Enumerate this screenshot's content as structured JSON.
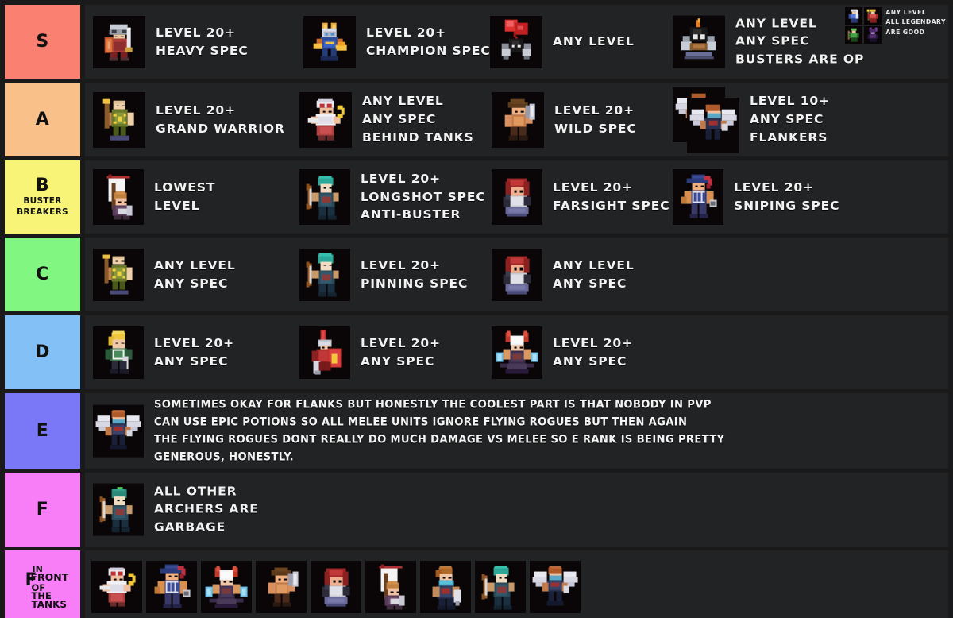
{
  "meta": {
    "background": "#1a1a1a",
    "row_bg": "#222325",
    "thumb_bg": "#0a0607",
    "text_color": "#f2f2f2"
  },
  "legend": {
    "lines": [
      "ANY LEVEL",
      "ALL LEGENDARY",
      "ARE GOOD"
    ],
    "thumbs": [
      "legendary-knight-icon",
      "legendary-mage-icon",
      "legendary-ranger-icon",
      "legendary-dark-icon"
    ]
  },
  "tiers": [
    {
      "id": "s",
      "label": "S",
      "sublabel": "",
      "color": "#fa8072",
      "entries": [
        {
          "icon": "heavy-knight-sprite",
          "lines": [
            "LEVEL 20+",
            "HEAVY SPEC"
          ]
        },
        {
          "icon": "champion-sprite",
          "lines": [
            "LEVEL 20+",
            "CHAMPION SPEC"
          ]
        },
        {
          "icon": "balloon-bomb-sprite",
          "lines": [
            "ANY LEVEL"
          ]
        },
        {
          "icon": "buster-bomb-sprite",
          "lines": [
            "ANY LEVEL",
            "ANY SPEC",
            "BUSTERS ARE OP"
          ]
        }
      ]
    },
    {
      "id": "a",
      "label": "A",
      "sublabel": "",
      "color": "#fac08a",
      "entries": [
        {
          "icon": "grand-warrior-sprite",
          "lines": [
            "LEVEL 20+",
            "GRAND WARRIOR"
          ]
        },
        {
          "icon": "white-cleric-sprite",
          "lines": [
            "ANY LEVEL",
            "ANY SPEC",
            "BEHIND TANKS"
          ]
        },
        {
          "icon": "wild-gunner-sprite",
          "lines": [
            "LEVEL 20+",
            "WILD SPEC"
          ]
        },
        {
          "icon": "flying-rogue-pair-sprite",
          "lines": [
            "LEVEL 10+",
            "ANY SPEC",
            "FLANKERS"
          ]
        }
      ]
    },
    {
      "id": "b",
      "label": "B",
      "sublabel": "BUSTER\nBREAKERS",
      "color": "#f7f478",
      "entries": [
        {
          "icon": "banner-bearer-sprite",
          "lines": [
            "LOWEST",
            "LEVEL"
          ]
        },
        {
          "icon": "longshot-archer-sprite",
          "lines": [
            "LEVEL 20+",
            "LONGSHOT SPEC",
            "ANTI-BUSTER"
          ]
        },
        {
          "icon": "farsight-gunner-sprite",
          "lines": [
            "LEVEL 20+",
            "FARSIGHT SPEC"
          ]
        },
        {
          "icon": "sniper-captain-sprite",
          "lines": [
            "LEVEL 20+",
            "SNIPING SPEC"
          ]
        }
      ]
    },
    {
      "id": "c",
      "label": "C",
      "sublabel": "",
      "color": "#81f781",
      "entries": [
        {
          "icon": "grand-warrior-sprite",
          "lines": [
            "ANY LEVEL",
            "ANY SPEC"
          ]
        },
        {
          "icon": "pinning-archer-sprite",
          "lines": [
            "LEVEL 20+",
            "PINNING SPEC"
          ]
        },
        {
          "icon": "farsight-gunner-sprite",
          "lines": [
            "ANY LEVEL",
            "ANY SPEC"
          ]
        }
      ]
    },
    {
      "id": "d",
      "label": "D",
      "sublabel": "",
      "color": "#82c0f5",
      "entries": [
        {
          "icon": "blonde-duelist-sprite",
          "lines": [
            "LEVEL 20+",
            "ANY SPEC"
          ]
        },
        {
          "icon": "red-shield-knight-sprite",
          "lines": [
            "LEVEL 20+",
            "ANY SPEC"
          ]
        },
        {
          "icon": "horned-caster-sprite",
          "lines": [
            "LEVEL 20+",
            "ANY SPEC"
          ]
        }
      ]
    },
    {
      "id": "e",
      "label": "E",
      "sublabel": "",
      "color": "#7b78f7",
      "entries": [
        {
          "icon": "flying-rogue-sprite",
          "paragraph": [
            "SOMETIMES OKAY FOR FLANKS BUT HONESTLY THE COOLEST PART IS THAT NOBODY IN PVP",
            "CAN USE EPIC POTIONS SO ALL MELEE UNITS IGNORE FLYING ROGUES BUT THEN AGAIN",
            "THE FLYING ROGUES DONT REALLY DO MUCH DAMAGE VS MELEE SO E RANK IS BEING PRETTY",
            "GENEROUS, HONESTLY."
          ]
        }
      ]
    },
    {
      "id": "f",
      "label": "F",
      "sublabel": "",
      "color": "#f77ef7",
      "entries": [
        {
          "icon": "green-hood-archer-sprite",
          "lines": [
            "ALL OTHER",
            "ARCHERS ARE",
            "GARBAGE"
          ]
        }
      ]
    },
    {
      "id": "front",
      "label": "F",
      "sublabel": "IN FRONT OF THE TANKS",
      "stacked_label": [
        "IN",
        "FRONT",
        "OF",
        "THE",
        "TANKS"
      ],
      "color": "#f77ef7",
      "strip": [
        "white-cleric-sprite",
        "sniper-captain-sprite",
        "horned-caster-sprite",
        "wild-gunner-sprite",
        "farsight-gunner-sprite",
        "banner-bearer-sprite",
        "blue-scarf-ranger-sprite",
        "pinning-archer-sprite",
        "flying-rogue-sprite"
      ]
    }
  ]
}
